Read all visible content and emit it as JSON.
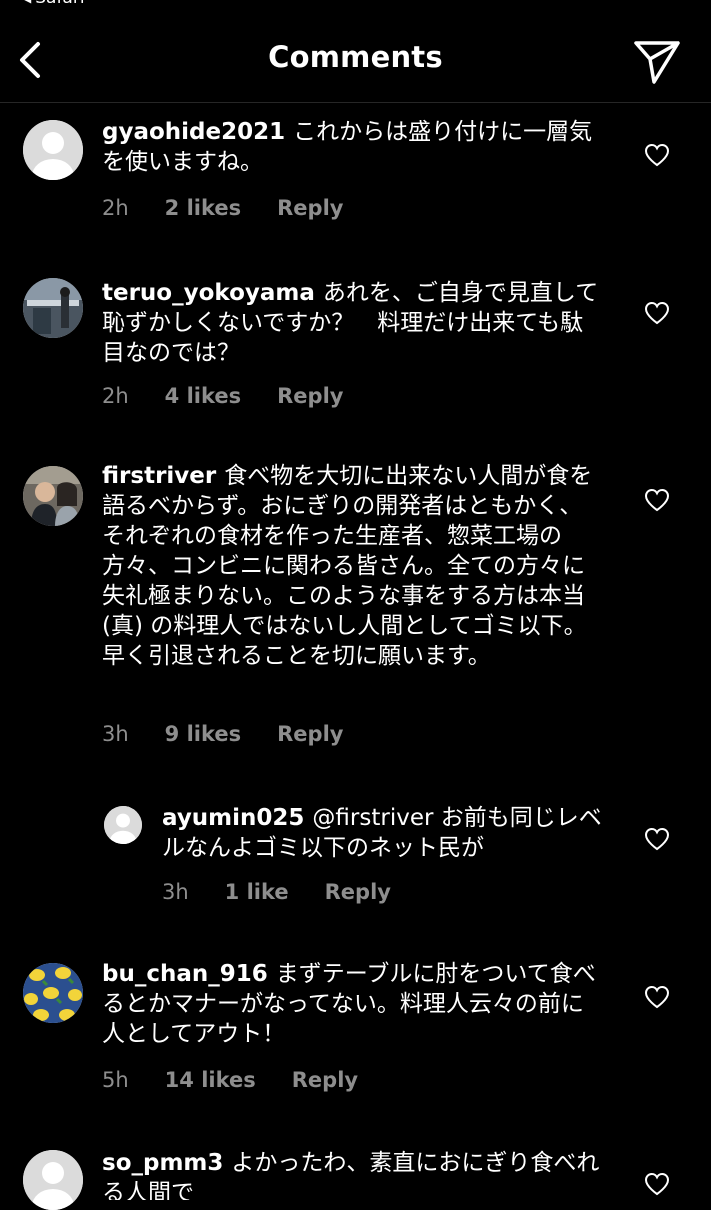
{
  "status_bar": {
    "back_app": "Safari"
  },
  "header": {
    "title": "Comments"
  },
  "comments": [
    {
      "username": "gyaohide2021",
      "text": "これからは盛り付けに一層気を使いますね。",
      "time": "2h",
      "likes": "2 likes",
      "reply": "Reply",
      "avatar": "default-avatar"
    },
    {
      "username": "teruo_yokoyama",
      "text": "あれを、ご自身で見直して恥ずかしくないですか？　料理だけ出来ても駄目なのでは？",
      "time": "2h",
      "likes": "4 likes",
      "reply": "Reply",
      "avatar": "photo-avatar"
    },
    {
      "username": "firstriver",
      "text": "食べ物を大切に出来ない人間が食を語るべからず。おにぎりの開発者はともかく、それぞれの食材を作った生産者、惣菜工場の方々、コンビニに関わる皆さん。全ての方々に失礼極まりない。このような事をする方は本当 (真) の料理人ではないし人間としてゴミ以下。早く引退されることを切に願います。",
      "time": "3h",
      "likes": "9 likes",
      "reply": "Reply",
      "avatar": "photo-avatar"
    },
    {
      "username": "ayumin025",
      "text": "@firstriver  お前も同じレベルなんよゴミ以下のネット民が",
      "time": "3h",
      "likes": "1 like",
      "reply": "Reply",
      "avatar": "default-avatar"
    },
    {
      "username": "bu_chan_916",
      "text": "まずテーブルに肘をついて食べるとかマナーがなってない。料理人云々の前に人としてアウト！",
      "time": "5h",
      "likes": "14 likes",
      "reply": "Reply",
      "avatar": "lemon-pattern-avatar"
    },
    {
      "username": "so_pmm3",
      "text": "よかったわ、素直におにぎり食べれる人間で",
      "avatar": "default-avatar"
    }
  ],
  "colors": {
    "background": "#000000",
    "text": "#ffffff",
    "meta": "#8e8e8e",
    "divider": "#262626"
  }
}
